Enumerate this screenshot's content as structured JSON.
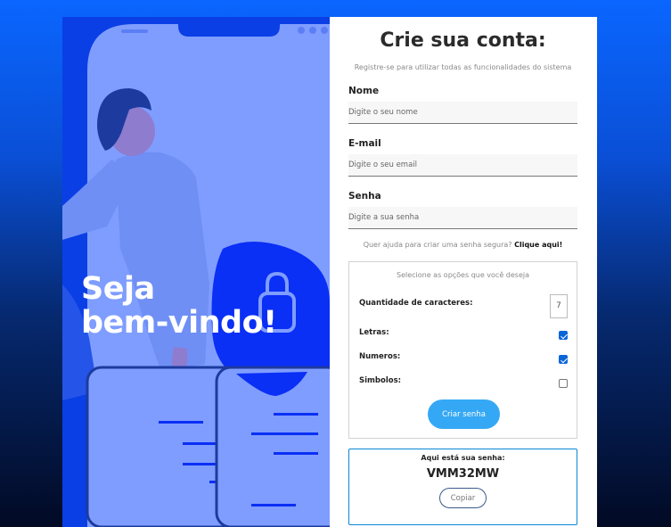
{
  "welcome": {
    "line1": "Seja",
    "line2": "bem-vindo!"
  },
  "form": {
    "title": "Crie sua conta:",
    "subtitle": "Registre-se para utilizar todas as funcionalidades do sistema",
    "name_label": "Nome",
    "name_placeholder": "Digite o seu nome",
    "email_label": "E-mail",
    "email_placeholder": "Digite o seu email",
    "password_label": "Senha",
    "password_placeholder": "Digite a sua senha",
    "help_text": "Quer ajuda para criar uma senha segura?",
    "help_link": "Clique aqui!"
  },
  "generator": {
    "title": "Selecione as opções que você deseja",
    "length_label": "Quantidade de caracteres:",
    "length_value": "7",
    "letters_label": "Letras:",
    "letters_checked": true,
    "numbers_label": "Numeros:",
    "numbers_checked": true,
    "symbols_label": "Simbolos:",
    "symbols_checked": false,
    "create_button": "Criar senha"
  },
  "result": {
    "label": "Aqui está sua senha:",
    "password": "VMM32MW",
    "copy_button": "Copiar"
  },
  "colors": {
    "accent_button": "#35a8f5",
    "illustration_blue": "#0a3fe6",
    "illustration_light": "#7f9dff",
    "result_border": "#0a86d6"
  },
  "icons": {
    "lock": "lock-icon"
  }
}
